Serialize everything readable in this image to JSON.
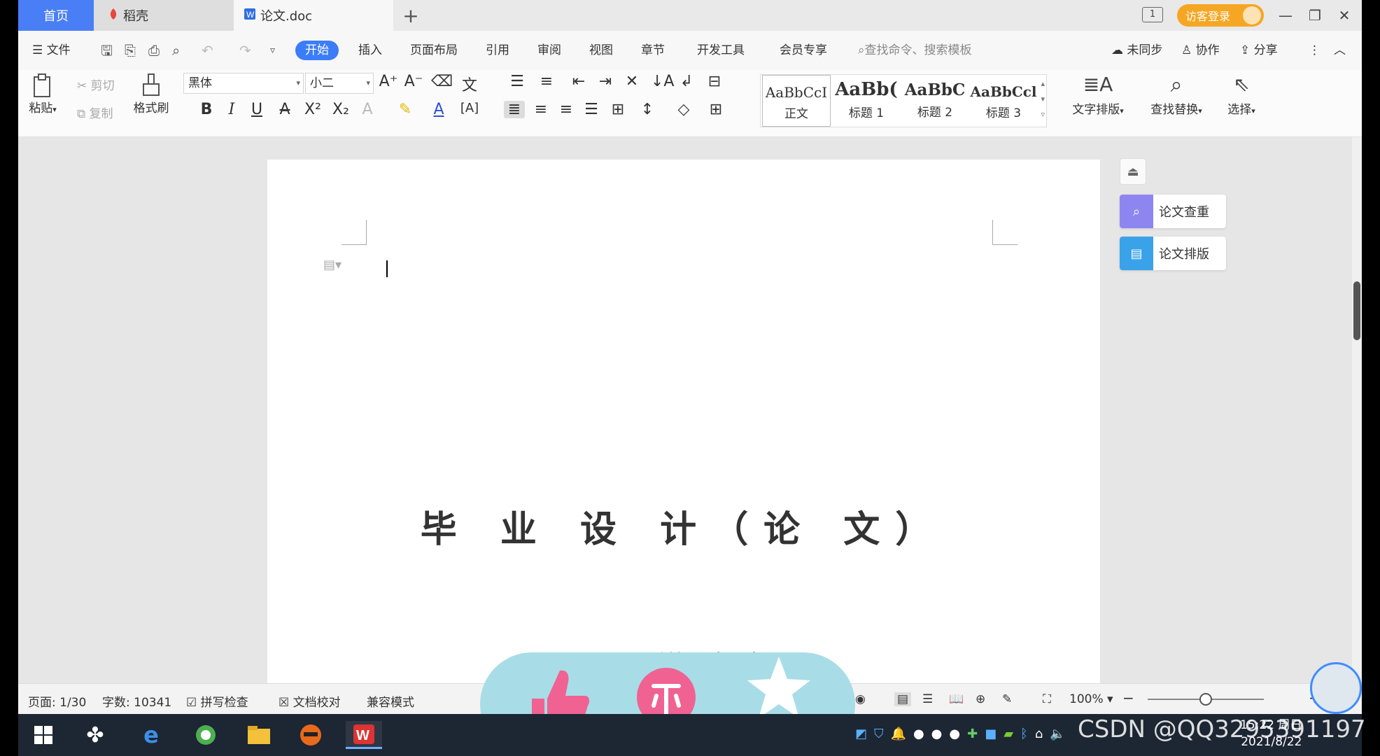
{
  "tabs": {
    "home": "首页",
    "daoke": "稻壳",
    "doc": "论文.doc",
    "add": "+"
  },
  "titlebar": {
    "login": "访客登录",
    "page_indicator": "1"
  },
  "menu": {
    "file": "文件",
    "items": [
      "开始",
      "插入",
      "页面布局",
      "引用",
      "审阅",
      "视图",
      "章节",
      "开发工具",
      "会员专享"
    ],
    "search": "查找命令、搜索模板",
    "unsynced": "未同步",
    "collab": "协作",
    "share": "分享"
  },
  "ribbon": {
    "paste": "粘贴",
    "cut": "剪切",
    "copy": "复制",
    "format_painter": "格式刷",
    "font": "黑体",
    "size": "小二",
    "styles": [
      {
        "preview": "AaBbCcI",
        "name": "正文"
      },
      {
        "preview": "AaBb(",
        "name": "标题 1"
      },
      {
        "preview": "AaBbC",
        "name": "标题 2"
      },
      {
        "preview": "AaBbCcl",
        "name": "标题 3"
      }
    ],
    "text_layout": "文字排版",
    "find_replace": "查找替换",
    "select": "选择"
  },
  "document": {
    "title": "毕 业 设 计（论 文）",
    "subtitle_partial": "题目：开…系统设计与实现"
  },
  "side_panel": {
    "check": "论文查重",
    "layout": "论文排版"
  },
  "status": {
    "page": "页面: 1/30",
    "words": "字数: 10341",
    "spell": "拼写检查",
    "proof": "文档校对",
    "compat": "兼容模式",
    "zoom": "100%",
    "zoom_level": 0.5
  },
  "taskbar": {
    "time": "15:22 周日",
    "date": "2021/8/22",
    "watermark": "CSDN @QQ3295391197"
  },
  "colors": {
    "accent": "#3b7df8",
    "login": "#f5a623",
    "overlay": "#a8dde7",
    "thumb": "#f06292"
  }
}
